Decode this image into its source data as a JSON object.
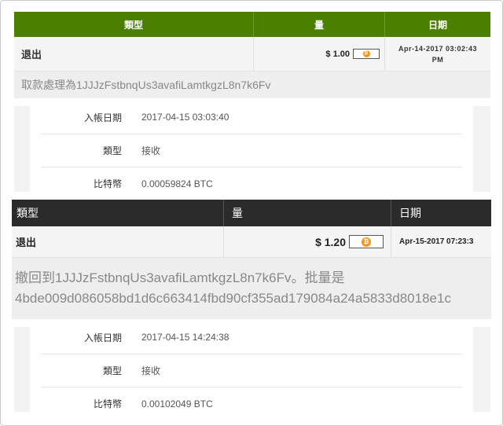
{
  "withdrawal_1": {
    "header": {
      "type": "類型",
      "amount": "量",
      "date": "日期"
    },
    "type": "退出",
    "amount": "$ 1.00",
    "date_line1": "Apr-14-2017 03:02:43",
    "date_line2": "PM",
    "detail": "取款處理為1JJJzFstbnqUs3avafiLamtkgzL8n7k6Fv",
    "coin_icon": "bitcoin-icon"
  },
  "receive_1": {
    "date_label": "入帳日期",
    "date_value": "2017-04-15 03:03:40",
    "type_label": "類型",
    "type_value": "接收",
    "btc_label": "比特幣",
    "btc_value": "0.00059824 BTC"
  },
  "withdrawal_2": {
    "header": {
      "type": "類型",
      "amount": "量",
      "date": "日期"
    },
    "type": "退出",
    "amount": "$ 1.20",
    "date": "Apr-15-2017 07:23:3",
    "detail_line1": "撤回到1JJJzFstbnqUs3avafiLamtkgzL8n7k6Fv。批量是",
    "detail_line2": "4bde009d086058bd1d6c663414fbd90cf355ad179084a24a5833d8018e1c",
    "coin_icon": "bitcoin-icon"
  },
  "receive_2": {
    "date_label": "入帳日期",
    "date_value": "2017-04-15 14:24:38",
    "type_label": "類型",
    "type_value": "接收",
    "btc_label": "比特幣",
    "btc_value": "0.00102049 BTC"
  },
  "colors": {
    "green_header": "#4a7f00",
    "dark_header": "#2b2b2b",
    "bitcoin": "#f7931a"
  }
}
